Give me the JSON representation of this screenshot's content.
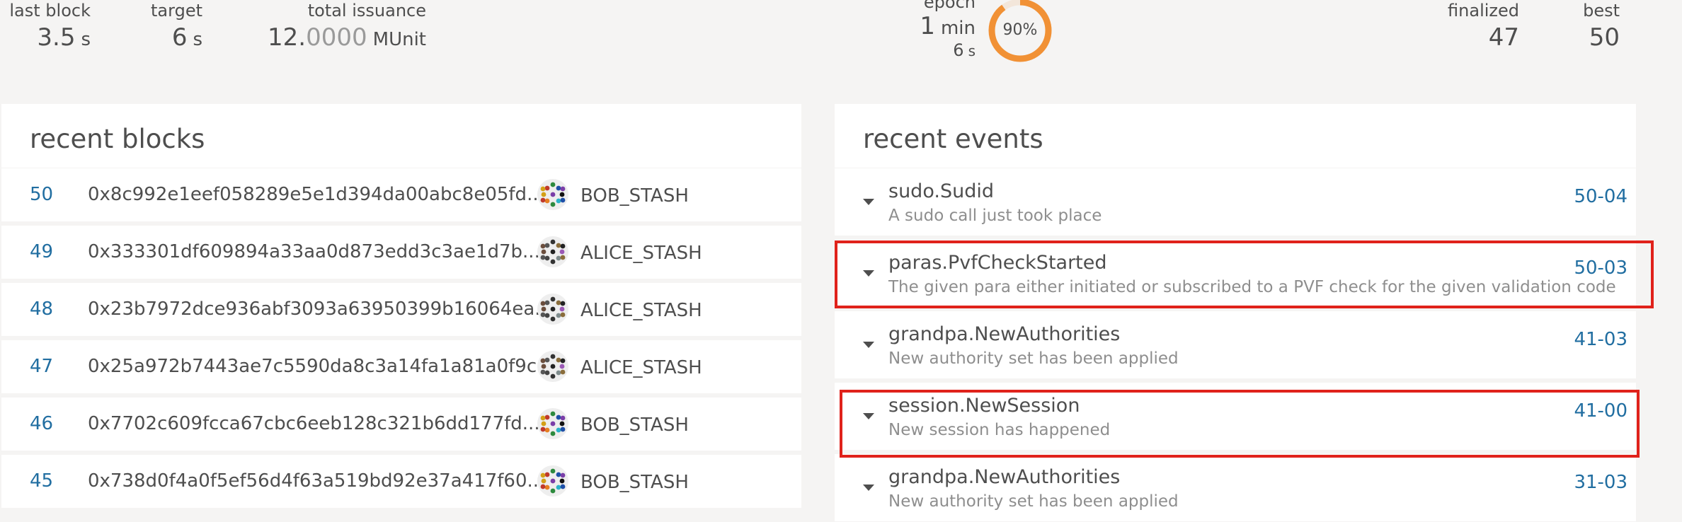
{
  "stats": {
    "last_block": {
      "label": "last block",
      "value": "3.5",
      "unit": "s"
    },
    "target": {
      "label": "target",
      "value": "6",
      "unit": "s"
    },
    "total_issuance": {
      "label": "total issuance",
      "value_main": "12.",
      "value_dim": "0000",
      "unit": "MUnit"
    },
    "epoch": {
      "label": "epoch",
      "value": "1",
      "unit": "min",
      "sub_value": "6",
      "sub_unit": "s",
      "progress_label": "90%",
      "progress": 0.9
    },
    "finalized": {
      "label": "finalized",
      "value": "47"
    },
    "best": {
      "label": "best",
      "value": "50"
    }
  },
  "colors": {
    "link": "#216ea1",
    "ring": "#f19135",
    "highlight": "#e0221b"
  },
  "recent_blocks": {
    "title": "recent blocks",
    "rows": [
      {
        "number": "50",
        "hash": "0x8c992e1eef058289e5e1d394da00abc8e05fd...",
        "author": "BOB_STASH"
      },
      {
        "number": "49",
        "hash": "0x333301df609894a33aa0d873edd3c3ae1d7b...",
        "author": "ALICE_STASH"
      },
      {
        "number": "48",
        "hash": "0x23b7972dce936abf3093a63950399b16064ea...",
        "author": "ALICE_STASH"
      },
      {
        "number": "47",
        "hash": "0x25a972b7443ae7c5590da8c3a14fa1a81a0f9c...",
        "author": "ALICE_STASH"
      },
      {
        "number": "46",
        "hash": "0x7702c609fcca67cbc6eeb128c321b6dd177fd...",
        "author": "BOB_STASH"
      },
      {
        "number": "45",
        "hash": "0x738d0f4a0f5ef56d4f63a519bd92e37a417f60...",
        "author": "BOB_STASH"
      }
    ]
  },
  "recent_events": {
    "title": "recent events",
    "rows": [
      {
        "title": "sudo.Sudid",
        "desc": "A sudo call just took place",
        "index": "50-04"
      },
      {
        "title": "paras.PvfCheckStarted",
        "desc": "The given para either initiated or subscribed to a PVF check for the given validation code",
        "index": "50-03"
      },
      {
        "title": "grandpa.NewAuthorities",
        "desc": "New authority set has been applied",
        "index": "41-03"
      },
      {
        "title": "session.NewSession",
        "desc": "New session has happened",
        "index": "41-00"
      },
      {
        "title": "grandpa.NewAuthorities",
        "desc": "New authority set has been applied",
        "index": "31-03"
      }
    ]
  }
}
